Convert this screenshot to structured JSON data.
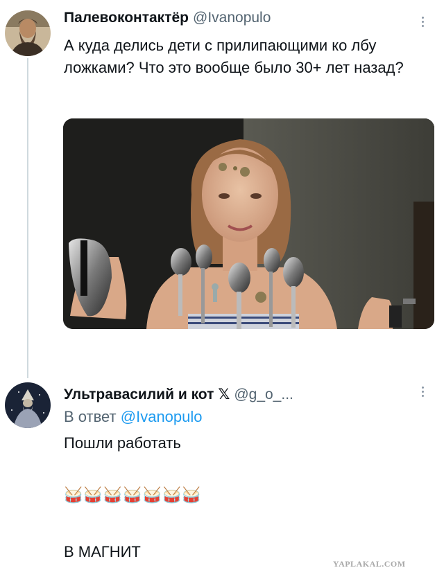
{
  "tweet1": {
    "display_name": "Палевоконтактёр",
    "handle": "@Ivanopulo",
    "text": "А куда делись дети с прилипающими ко лбу ложками? Что это вообще было 30+ лет назад?"
  },
  "tweet2": {
    "display_name": "Ультравасилий и кот",
    "badge": "𝕏",
    "handle": "@g_o_...",
    "reply_prefix": "В ответ",
    "reply_mention": "@Ivanopulo",
    "line1": "Пошли работать",
    "drums": "🥁🥁🥁🥁🥁🥁🥁",
    "line3": "В МАГНИТ"
  },
  "icons": {
    "more": "more-vertical-icon"
  },
  "colors": {
    "text": "#0f1419",
    "secondary": "#536471",
    "mention": "#1d9bf0",
    "thread_line": "#cfd9de"
  },
  "watermark": "YAPLAKAL.COM"
}
